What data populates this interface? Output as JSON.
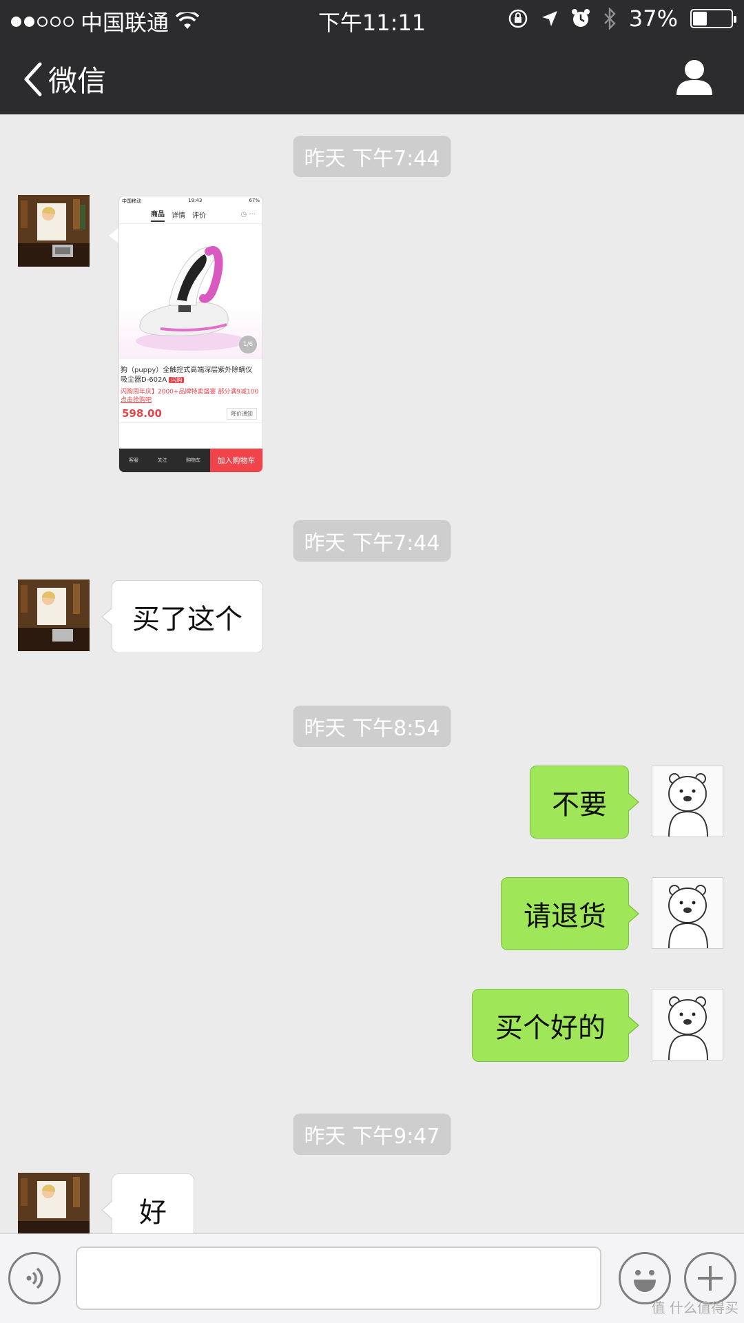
{
  "status_bar": {
    "carrier": "中国联通",
    "time": "下午11:11",
    "battery_percent": "37%",
    "battery_level": 0.37,
    "signal_bars_filled": 2,
    "signal_bars_total": 5
  },
  "nav": {
    "back_label": "微信",
    "back_icon": "chevron-left-icon",
    "profile_icon": "person-icon"
  },
  "messages": [
    {
      "kind": "timestamp",
      "text": "昨天 下午7:44"
    },
    {
      "kind": "image",
      "from": "contact",
      "product_screenshot": {
        "carrier": "中国移动",
        "time": "19:43",
        "battery": "67%",
        "tabs": [
          "商品",
          "详情",
          "评价"
        ],
        "page_indicator": "1/6",
        "title": "狗（puppy）全触控式高端深层紫外除螨仪吸尘器D-602A",
        "tag": "闪购",
        "promo": "闪购周年庆】2000+品牌特卖盛宴 部分满9减100",
        "promo_link": "点击抢购吧",
        "price": "598.00",
        "notify": "降价通知",
        "bottom_labels": [
          "客服",
          "关注",
          "购物车"
        ],
        "cart_button": "加入购物车"
      }
    },
    {
      "kind": "timestamp",
      "text": "昨天 下午7:44"
    },
    {
      "kind": "text",
      "from": "contact",
      "text": "买了这个"
    },
    {
      "kind": "timestamp",
      "text": "昨天 下午8:54"
    },
    {
      "kind": "text",
      "from": "me",
      "text": "不要"
    },
    {
      "kind": "text",
      "from": "me",
      "text": "请退货"
    },
    {
      "kind": "text",
      "from": "me",
      "text": "买个好的"
    },
    {
      "kind": "timestamp",
      "text": "昨天 下午9:47"
    },
    {
      "kind": "text",
      "from": "contact",
      "text": "好"
    }
  ],
  "input_bar": {
    "voice_icon": "voice-icon",
    "input_value": "",
    "emoji_icon": "emoji-icon",
    "plus_icon": "plus-icon"
  },
  "watermark": "值 什么值得买",
  "colors": {
    "bar_bg": "#2c2c2e",
    "chat_bg": "#ebebeb",
    "my_bubble": "#9fe658",
    "their_bubble": "#ffffff",
    "timestamp_bg": "#cecece",
    "price_red": "#e8434a"
  }
}
